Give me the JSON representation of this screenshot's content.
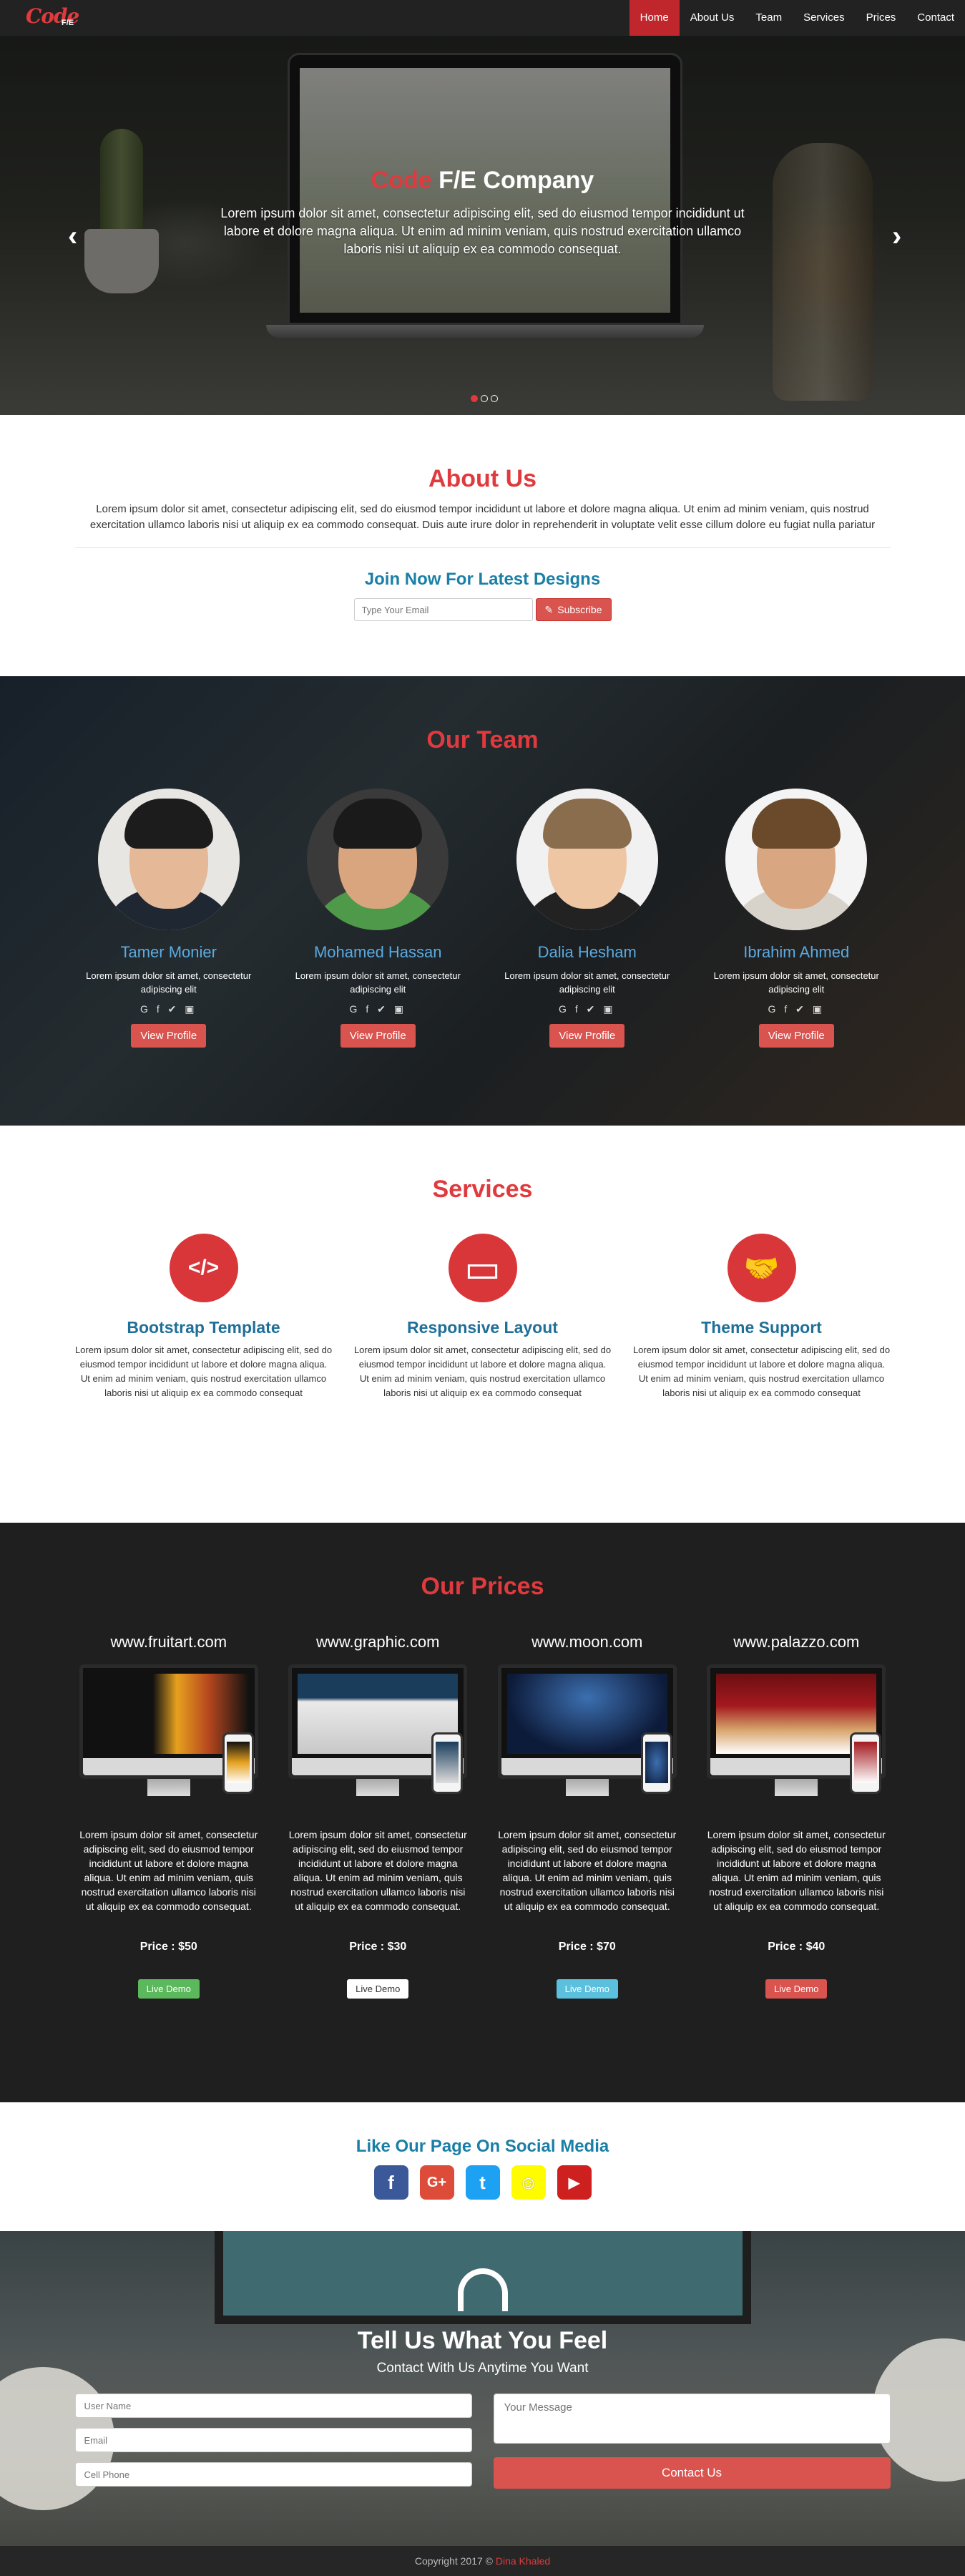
{
  "nav": {
    "logo_script": "Code",
    "logo_suffix": "F/E",
    "items": [
      {
        "label": "Home",
        "active": true
      },
      {
        "label": "About Us"
      },
      {
        "label": "Team"
      },
      {
        "label": "Services"
      },
      {
        "label": "Prices"
      },
      {
        "label": "Contact"
      }
    ]
  },
  "hero": {
    "title_red": "Code",
    "title_rest": " F/E Company",
    "text": "Lorem ipsum dolor sit amet, consectetur adipiscing elit, sed do eiusmod tempor incididunt ut labore et dolore magna aliqua. Ut enim ad minim veniam, quis nostrud exercitation ullamco laboris nisi ut aliquip ex ea commodo consequat.",
    "prev_arrow": "‹",
    "next_arrow": "›",
    "slides": 3,
    "active_slide": 1
  },
  "about": {
    "title": "About Us",
    "text": "Lorem ipsum dolor sit amet, consectetur adipiscing elit, sed do eiusmod tempor incididunt ut labore et dolore magna aliqua. Ut enim ad minim veniam, quis nostrud exercitation ullamco laboris nisi ut aliquip ex ea commodo consequat. Duis aute irure dolor in reprehenderit in voluptate velit esse cillum dolore eu fugiat nulla pariatur",
    "join_title": "Join Now For Latest Designs",
    "email_placeholder": "Type Your Email",
    "subscribe_label": "Subscribe"
  },
  "team": {
    "title": "Our Team",
    "members": [
      {
        "name": "Tamer Monier",
        "desc": "Lorem ipsum dolor sit amet, consectetur adipiscing elit",
        "icons": "G f ✔ ▣",
        "button": "View Profile"
      },
      {
        "name": "Mohamed Hassan",
        "desc": "Lorem ipsum dolor sit amet, consectetur adipiscing elit",
        "icons": "G f ✔ ▣",
        "button": "View Profile"
      },
      {
        "name": "Dalia Hesham",
        "desc": "Lorem ipsum dolor sit amet, consectetur adipiscing elit",
        "icons": "G f ✔ ▣",
        "button": "View Profile"
      },
      {
        "name": "Ibrahim Ahmed",
        "desc": "Lorem ipsum dolor sit amet, consectetur adipiscing elit",
        "icons": "G f ✔ ▣",
        "button": "View Profile"
      }
    ]
  },
  "services": {
    "title": "Services",
    "items": [
      {
        "icon": "</>",
        "title": "Bootstrap Template",
        "text": "Lorem ipsum dolor sit amet, consectetur adipiscing elit, sed do eiusmod tempor incididunt ut labore et dolore magna aliqua. Ut enim ad minim veniam, quis nostrud exercitation ullamco laboris nisi ut aliquip ex ea commodo consequat"
      },
      {
        "icon": "▭",
        "title": "Responsive Layout",
        "text": "Lorem ipsum dolor sit amet, consectetur adipiscing elit, sed do eiusmod tempor incididunt ut labore et dolore magna aliqua. Ut enim ad minim veniam, quis nostrud exercitation ullamco laboris nisi ut aliquip ex ea commodo consequat"
      },
      {
        "icon": "🤝",
        "title": "Theme Support",
        "text": "Lorem ipsum dolor sit amet, consectetur adipiscing elit, sed do eiusmod tempor incididunt ut labore et dolore magna aliqua. Ut enim ad minim veniam, quis nostrud exercitation ullamco laboris nisi ut aliquip ex ea commodo consequat"
      }
    ]
  },
  "prices": {
    "title": "Our Prices",
    "items": [
      {
        "site": "www.fruitart.com",
        "desc": "Lorem ipsum dolor sit amet, consectetur adipiscing elit, sed do eiusmod tempor incididunt ut labore et dolore magna aliqua. Ut enim ad minim veniam, quis nostrud exercitation ullamco laboris nisi ut aliquip ex ea commodo consequat.",
        "price": "Price : $50",
        "button": "Live Demo",
        "btn_color": "#5cb85c"
      },
      {
        "site": "www.graphic.com",
        "desc": "Lorem ipsum dolor sit amet, consectetur adipiscing elit, sed do eiusmod tempor incididunt ut labore et dolore magna aliqua. Ut enim ad minim veniam, quis nostrud exercitation ullamco laboris nisi ut aliquip ex ea commodo consequat.",
        "price": "Price : $30",
        "button": "Live Demo",
        "btn_color": "#ffffff"
      },
      {
        "site": "www.moon.com",
        "desc": "Lorem ipsum dolor sit amet, consectetur adipiscing elit, sed do eiusmod tempor incididunt ut labore et dolore magna aliqua. Ut enim ad minim veniam, quis nostrud exercitation ullamco laboris nisi ut aliquip ex ea commodo consequat.",
        "price": "Price : $70",
        "button": "Live Demo",
        "btn_color": "#5bc0de"
      },
      {
        "site": "www.palazzo.com",
        "desc": "Lorem ipsum dolor sit amet, consectetur adipiscing elit, sed do eiusmod tempor incididunt ut labore et dolore magna aliqua. Ut enim ad minim veniam, quis nostrud exercitation ullamco laboris nisi ut aliquip ex ea commodo consequat.",
        "price": "Price : $40",
        "button": "Live Demo",
        "btn_color": "#d9534f"
      }
    ]
  },
  "social": {
    "title": "Like Our Page On Social Media",
    "icons": [
      {
        "name": "facebook-icon",
        "glyph": "f",
        "color": "#3b5998"
      },
      {
        "name": "google-plus-icon",
        "glyph": "G+",
        "color": "#dd4b39"
      },
      {
        "name": "twitter-icon",
        "glyph": "t",
        "color": "#1da1f2"
      },
      {
        "name": "snapchat-icon",
        "glyph": "☺",
        "color": "#fffc00"
      },
      {
        "name": "youtube-icon",
        "glyph": "▶",
        "color": "#cd201f"
      }
    ]
  },
  "contact": {
    "title": "Tell Us What You Feel",
    "subtitle": "Contact With Us Anytime You Want",
    "name_placeholder": "User Name",
    "email_placeholder": "Email",
    "phone_placeholder": "Cell Phone",
    "message_placeholder": "Your Message",
    "button": "Contact Us"
  },
  "footer": {
    "text": "Copyright 2017 © ",
    "author": "Dina Khaled"
  }
}
